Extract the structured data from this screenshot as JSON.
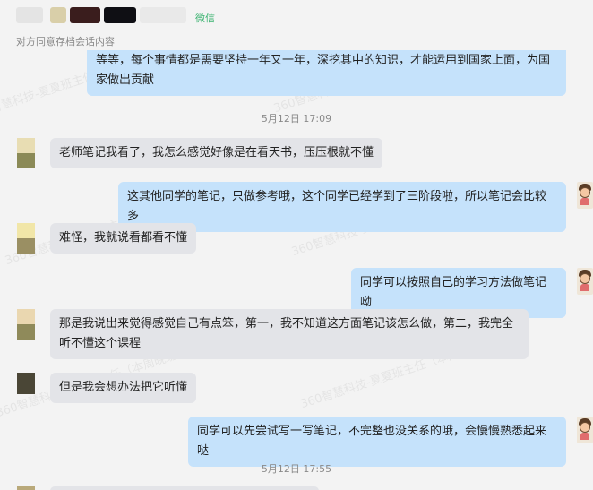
{
  "header": {
    "tag": "微信",
    "subtitle": "对方同意存档会话内容"
  },
  "colors": {
    "incoming_bubble": "#e3e4e8",
    "outgoing_bubble": "#c5e2fb",
    "background": "#f3f3f3",
    "wechat_tag": "#3cb371"
  },
  "watermark": "360智慧科技-夏夏班主任（本周晚班）",
  "messages": [
    {
      "dir": "out",
      "text": "等等，每个事情都是需要坚持一年又一年，深挖其中的知识，才能运用到国家上面，为国家做出贡献"
    },
    {
      "timestamp": "5月12日 17:09"
    },
    {
      "dir": "in",
      "text": "老师笔记我看了，我怎么感觉好像是在看天书，压压根就不懂"
    },
    {
      "dir": "out",
      "text": "这其他同学的笔记，只做参考哦，这个同学已经学到了三阶段啦，所以笔记会比较多"
    },
    {
      "dir": "in",
      "text": "难怪，我就说看都看不懂"
    },
    {
      "dir": "out",
      "text": "同学可以按照自己的学习方法做笔记呦"
    },
    {
      "dir": "in",
      "text": "那是我说出来觉得感觉自己有点笨，第一，我不知道这方面笔记该怎么做，第二，我完全听不懂这个课程"
    },
    {
      "dir": "in",
      "text": "但是我会想办法把它听懂"
    },
    {
      "dir": "out",
      "text": "同学可以先尝试写一写笔记，不完整也没关系的哦，会慢慢熟悉起来哒"
    },
    {
      "timestamp": "5月12日 17:55"
    }
  ]
}
